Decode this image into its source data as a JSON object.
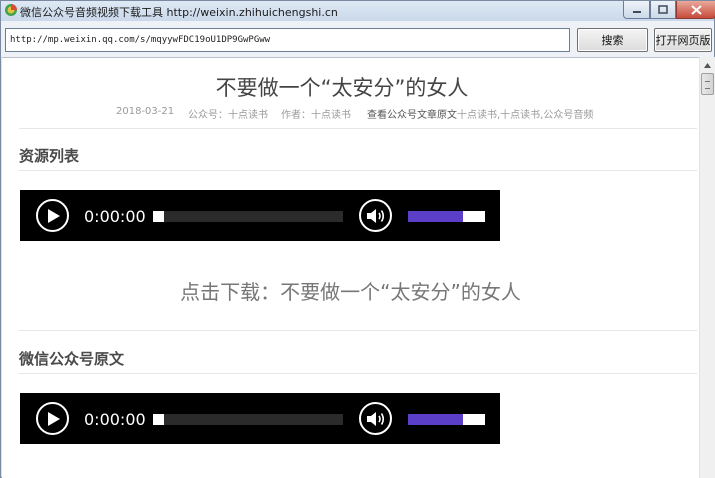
{
  "window": {
    "title": "微信公众号音频视频下载工具 http://weixin.zhihuichengshi.cn"
  },
  "toolbar": {
    "url_value": "http://mp.weixin.qq.com/s/mqyywFDC19oU1DP9GwPGww",
    "search_label": "搜索",
    "open_label": "打开网页版"
  },
  "article": {
    "title": "不要做一个“太安分”的女人",
    "date": "2018-03-21",
    "account": "公众号：十点读书",
    "author": "作者：十点读书",
    "view_original": "查看公众号文章原文",
    "tags": "十点读书,十点读书,公众号音频"
  },
  "sections": {
    "resources_heading": "资源列表",
    "original_heading": "微信公众号原文"
  },
  "players": [
    {
      "time": "0:00:00",
      "progress": 0,
      "volume": 0.85
    },
    {
      "time": "0:00:00",
      "progress": 0,
      "volume": 0.85
    }
  ],
  "download_link": "点击下载：不要做一个“太安分”的女人",
  "colors": {
    "volume_fill": "#5b3fc8",
    "player_bg": "#000000",
    "close_button": "#c74b3b"
  },
  "icons": [
    "app-icon",
    "minimize-icon",
    "maximize-icon",
    "close-icon",
    "play-icon",
    "volume-icon",
    "scroll-up-icon"
  ]
}
